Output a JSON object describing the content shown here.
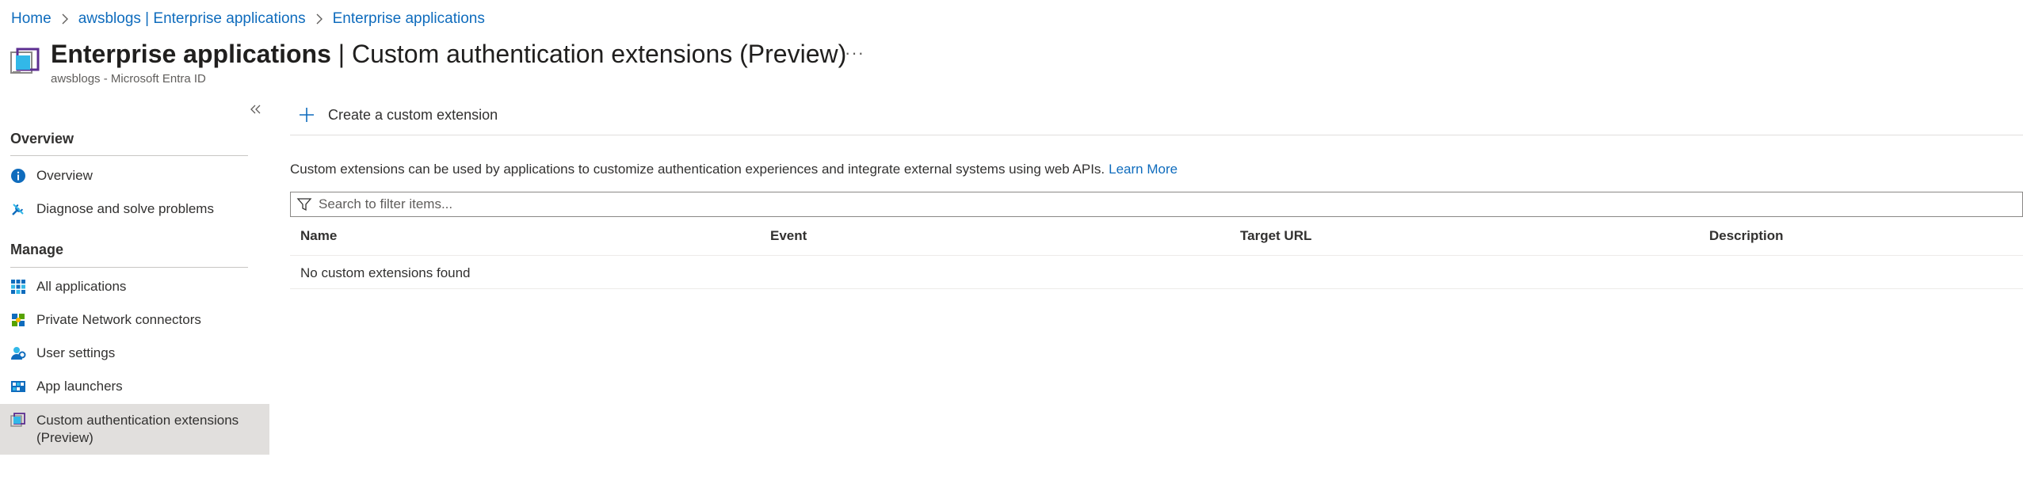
{
  "breadcrumb": [
    {
      "label": "Home"
    },
    {
      "label": "awsblogs | Enterprise applications"
    },
    {
      "label": "Enterprise applications"
    }
  ],
  "header": {
    "title_bold": "Enterprise applications",
    "title_rest": "| Custom authentication extensions (Preview)",
    "more_label": "···",
    "subtitle": "awsblogs - Microsoft Entra ID"
  },
  "sidebar": {
    "collapse_label": "«",
    "sections": [
      {
        "heading": "Overview",
        "items": [
          {
            "label": "Overview",
            "icon": "info-icon"
          },
          {
            "label": "Diagnose and solve problems",
            "icon": "wrench-icon"
          }
        ]
      },
      {
        "heading": "Manage",
        "items": [
          {
            "label": "All applications",
            "icon": "grid-icon"
          },
          {
            "label": "Private Network connectors",
            "icon": "connector-icon"
          },
          {
            "label": "User settings",
            "icon": "user-settings-icon"
          },
          {
            "label": "App launchers",
            "icon": "app-launcher-icon"
          },
          {
            "label": "Custom authentication extensions (Preview)",
            "icon": "custom-extension-icon",
            "active": true
          }
        ]
      }
    ]
  },
  "toolbar": {
    "create_label": "Create a custom extension"
  },
  "main": {
    "description": "Custom extensions can be used by applications to customize authentication experiences and integrate external systems using web APIs.",
    "learn_more": "Learn More",
    "search_placeholder": "Search to filter items...",
    "columns": [
      "Name",
      "Event",
      "Target URL",
      "Description"
    ],
    "empty_message": "No custom extensions found"
  },
  "colors": {
    "accent": "#0f6cbd",
    "active_nav": "#e1dfdd"
  }
}
